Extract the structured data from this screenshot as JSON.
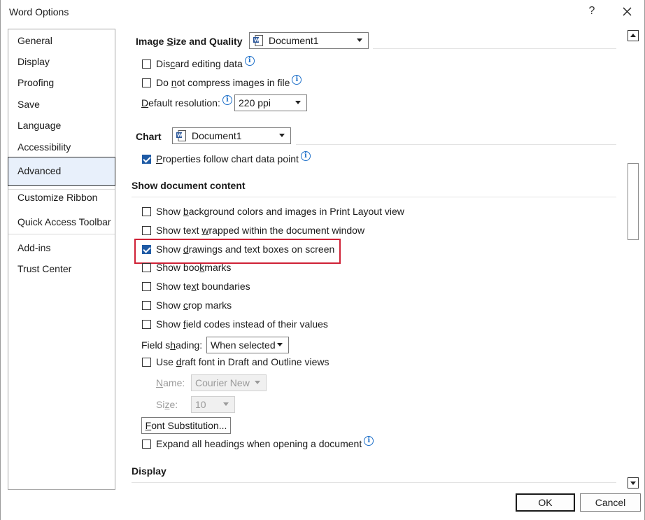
{
  "window": {
    "title": "Word Options",
    "help_label": "?"
  },
  "nav": {
    "items": [
      {
        "label": "General"
      },
      {
        "label": "Display"
      },
      {
        "label": "Proofing"
      },
      {
        "label": "Save"
      },
      {
        "label": "Language"
      },
      {
        "label": "Accessibility"
      },
      {
        "label": "Advanced",
        "selected": true
      },
      {
        "label": "Customize Ribbon"
      },
      {
        "label": "Quick Access Toolbar"
      },
      {
        "label": "Add-ins"
      },
      {
        "label": "Trust Center"
      }
    ]
  },
  "image_size": {
    "title_pre": "Image ",
    "title_key": "S",
    "title_post": "ize and Quality",
    "document": "Document1",
    "discard_pre": "Dis",
    "discard_key": "c",
    "discard_post": "ard editing data",
    "discard_checked": false,
    "compress_pre": "Do ",
    "compress_key": "n",
    "compress_post": "ot compress images in file",
    "compress_checked": false,
    "resolution_pre": "",
    "resolution_key": "D",
    "resolution_post": "efault resolution:",
    "resolution_value": "220 ppi"
  },
  "chart": {
    "title": "Chart",
    "document": "Document1",
    "props_pre": "",
    "props_key": "P",
    "props_post": "roperties follow chart data point",
    "props_checked": true
  },
  "show_content": {
    "title": "Show document content",
    "bg_pre": "Show ",
    "bg_key": "b",
    "bg_post": "ackground colors and images in Print Layout view",
    "bg_checked": false,
    "wrap_pre": "Show text ",
    "wrap_key": "w",
    "wrap_post": "rapped within the document window",
    "wrap_checked": false,
    "drawings_pre": "Show ",
    "drawings_key": "d",
    "drawings_post": "rawings and text boxes on screen",
    "drawings_checked": true,
    "bookmarks_pre": "Show boo",
    "bookmarks_key": "k",
    "bookmarks_post": "marks",
    "bookmarks_checked": false,
    "boundaries_pre": "Show te",
    "boundaries_key": "x",
    "boundaries_post": "t boundaries",
    "boundaries_checked": false,
    "crop_pre": "Show ",
    "crop_key": "c",
    "crop_post": "rop marks",
    "crop_checked": false,
    "field_codes_pre": "Show ",
    "field_codes_key": "f",
    "field_codes_post": "ield codes instead of their values",
    "field_codes_checked": false,
    "shading_pre": "Field s",
    "shading_key": "h",
    "shading_post": "ading:",
    "shading_value": "When selected",
    "draft_pre": "Use ",
    "draft_key": "d",
    "draft_post": "raft font in Draft and Outline views",
    "draft_checked": false,
    "name_pre": "",
    "name_key": "N",
    "name_post": "ame:",
    "name_value": "Courier New",
    "size_pre": "Si",
    "size_key": "z",
    "size_post": "e:",
    "size_value": "10",
    "font_sub_pre": "",
    "font_sub_key": "F",
    "font_sub_post": "ont Substitution...",
    "expand_pre": "Expand all headings when opening a document",
    "expand_checked": false
  },
  "display_section": {
    "title": "Display"
  },
  "footer": {
    "ok_label": "OK",
    "cancel_label": "Cancel"
  },
  "colors": {
    "accent": "#1e5aa5",
    "highlight": "#cf2136",
    "info": "#1d6fc9",
    "nav_selected_bg": "#e8f0fb"
  }
}
